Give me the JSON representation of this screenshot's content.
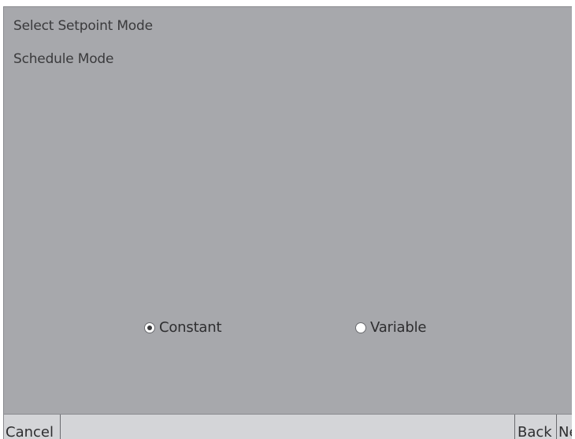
{
  "screen": {
    "title": "Select Setpoint Mode",
    "subtitle": "Schedule Mode",
    "options": [
      {
        "label": "Constant",
        "selected": true
      },
      {
        "label": "Variable",
        "selected": false
      }
    ]
  },
  "bottom_bar": {
    "cancel_label": "Cancel",
    "back_label": "Back",
    "next_label": "Ne"
  },
  "colors": {
    "screen_background": "#a7a8ac",
    "bottom_bar_background": "#d4d5d8",
    "text": "#3a3a3c"
  }
}
